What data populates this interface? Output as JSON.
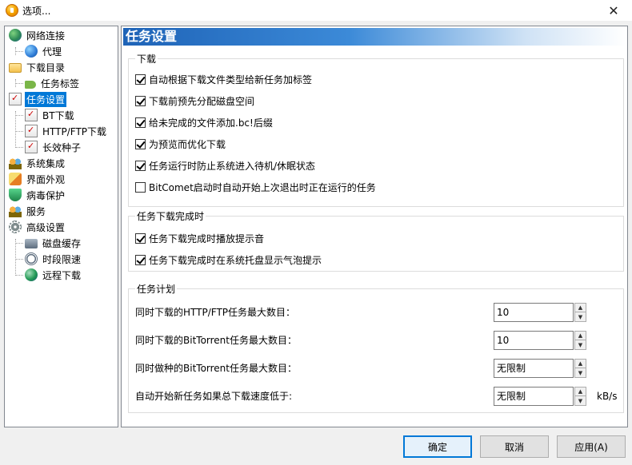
{
  "window": {
    "title": "选项...",
    "close_glyph": "✕"
  },
  "sidebar": {
    "items": [
      {
        "label": "网络连接",
        "icon": "globe-icon"
      },
      {
        "label": "代理",
        "icon": "proxy-icon"
      },
      {
        "label": "下载目录",
        "icon": "folder-icon"
      },
      {
        "label": "任务标签",
        "icon": "tag-icon"
      },
      {
        "label": "任务设置",
        "icon": "task-settings-icon",
        "selected": true
      },
      {
        "label": "BT下载",
        "icon": "task-icon"
      },
      {
        "label": "HTTP/FTP下载",
        "icon": "task-icon"
      },
      {
        "label": "长效种子",
        "icon": "task-icon"
      },
      {
        "label": "系统集成",
        "icon": "users-icon"
      },
      {
        "label": "界面外观",
        "icon": "paint-icon"
      },
      {
        "label": "病毒保护",
        "icon": "shield-icon"
      },
      {
        "label": "服务",
        "icon": "users-icon"
      },
      {
        "label": "高级设置",
        "icon": "gear-icon"
      },
      {
        "label": "磁盘缓存",
        "icon": "disk-icon"
      },
      {
        "label": "时段限速",
        "icon": "clock-icon"
      },
      {
        "label": "远程下载",
        "icon": "remote-icon"
      }
    ]
  },
  "main": {
    "title": "任务设置",
    "download_group": {
      "title": "下载",
      "options": [
        {
          "label": "自动根据下载文件类型给新任务加标签",
          "checked": true
        },
        {
          "label": "下载前预先分配磁盘空间",
          "checked": true
        },
        {
          "label": "给未完成的文件添加.bc!后缀",
          "checked": true
        },
        {
          "label": "为预览而优化下载",
          "checked": true
        },
        {
          "label": "任务运行时防止系统进入待机/休眠状态",
          "checked": true
        },
        {
          "label": "BitComet启动时自动开始上次退出时正在运行的任务",
          "checked": false
        }
      ]
    },
    "complete_group": {
      "title": "任务下载完成时",
      "options": [
        {
          "label": "任务下载完成时播放提示音",
          "checked": true
        },
        {
          "label": "任务下载完成时在系统托盘显示气泡提示",
          "checked": true
        }
      ]
    },
    "plan_group": {
      "title": "任务计划",
      "rows": [
        {
          "label": "同时下载的HTTP/FTP任务最大数目：",
          "value": "10"
        },
        {
          "label": "同时下载的BitTorrent任务最大数目：",
          "value": "10"
        },
        {
          "label": "同时做种的BitTorrent任务最大数目：",
          "value": "无限制"
        },
        {
          "label": "自动开始新任务如果总下载速度低于:",
          "value": "无限制",
          "unit": "kB/s"
        }
      ]
    }
  },
  "footer": {
    "ok_label": "确定",
    "cancel_label": "取消",
    "apply_label": "应用(A)"
  }
}
